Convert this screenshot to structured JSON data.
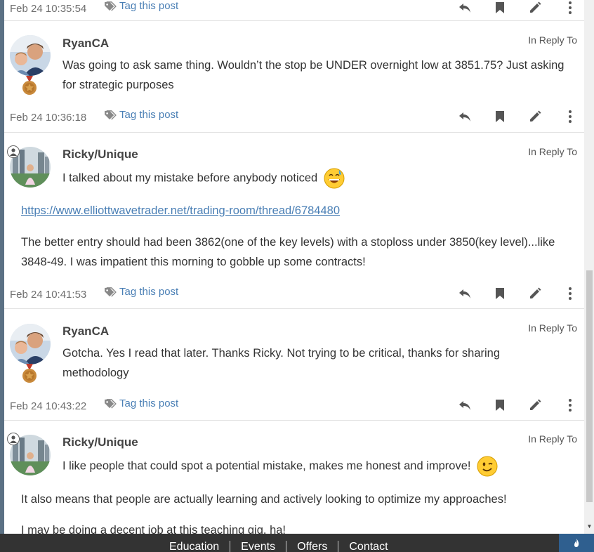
{
  "posts": [
    {
      "timestamp": "Feb 24 10:35:54",
      "tag_label": "Tag this post"
    },
    {
      "username": "RyanCA",
      "reply_to": "In Reply To",
      "text": "Was going to ask same thing. Wouldn’t the stop be UNDER overnight low at 3851.75? Just asking for strategic purposes",
      "timestamp": "Feb 24 10:36:18",
      "tag_label": "Tag this post"
    },
    {
      "username": "Ricky/Unique",
      "reply_to": "In Reply To",
      "text": "I talked about my mistake before anybody noticed",
      "link": "https://www.elliottwavetrader.net/trading-room/thread/6784480",
      "text2": "The better entry should had been 3862(one of the key levels) with a stoploss under 3850(key level)...like 3848-49. I was impatient this morning to gobble up some contracts!",
      "timestamp": "Feb 24 10:41:53",
      "tag_label": "Tag this post"
    },
    {
      "username": "RyanCA",
      "reply_to": "In Reply To",
      "text": "Gotcha. Yes I read that later. Thanks Ricky. Not trying to be critical, thanks for sharing methodology",
      "timestamp": "Feb 24 10:43:22",
      "tag_label": "Tag this post"
    },
    {
      "username": "Ricky/Unique",
      "reply_to": "In Reply To",
      "text": "I like people that could spot a potential mistake, makes me honest and improve!",
      "text2": "It also means that people are actually learning and actively looking to optimize my approaches!",
      "text3": "I may be doing a decent job at this teaching gig, ha!"
    }
  ],
  "footer": {
    "nav": [
      "Education",
      "Events",
      "Offers",
      "Contact"
    ]
  },
  "colors": {
    "link": "#4a7fb5",
    "footer_bg": "#333333",
    "rail": "#5b7184"
  }
}
